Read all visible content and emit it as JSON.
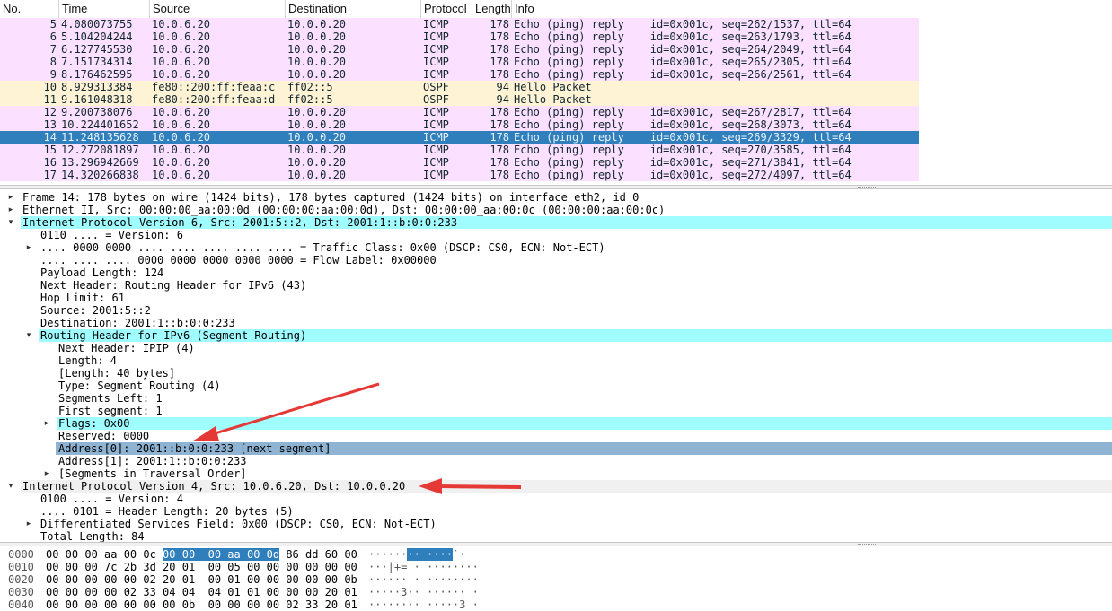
{
  "columns": [
    "No.",
    "Time",
    "Source",
    "Destination",
    "Protocol",
    "Length",
    "Info"
  ],
  "packets": [
    {
      "no": "5",
      "time": "4.080073755",
      "src": "10.0.6.20",
      "dst": "10.0.0.20",
      "proto": "ICMP",
      "len": "178",
      "info": "Echo (ping) reply    id=0x001c, seq=262/1537, ttl=64",
      "kind": "icmp"
    },
    {
      "no": "6",
      "time": "5.104204244",
      "src": "10.0.6.20",
      "dst": "10.0.0.20",
      "proto": "ICMP",
      "len": "178",
      "info": "Echo (ping) reply    id=0x001c, seq=263/1793, ttl=64",
      "kind": "icmp"
    },
    {
      "no": "7",
      "time": "6.127745530",
      "src": "10.0.6.20",
      "dst": "10.0.0.20",
      "proto": "ICMP",
      "len": "178",
      "info": "Echo (ping) reply    id=0x001c, seq=264/2049, ttl=64",
      "kind": "icmp"
    },
    {
      "no": "8",
      "time": "7.151734314",
      "src": "10.0.6.20",
      "dst": "10.0.0.20",
      "proto": "ICMP",
      "len": "178",
      "info": "Echo (ping) reply    id=0x001c, seq=265/2305, ttl=64",
      "kind": "icmp"
    },
    {
      "no": "9",
      "time": "8.176462595",
      "src": "10.0.6.20",
      "dst": "10.0.0.20",
      "proto": "ICMP",
      "len": "178",
      "info": "Echo (ping) reply    id=0x001c, seq=266/2561, ttl=64",
      "kind": "icmp"
    },
    {
      "no": "10",
      "time": "8.929313384",
      "src": "fe80::200:ff:feaa:c",
      "dst": "ff02::5",
      "proto": "OSPF",
      "len": "94",
      "info": "Hello Packet",
      "kind": "ospf"
    },
    {
      "no": "11",
      "time": "9.161048318",
      "src": "fe80::200:ff:feaa:d",
      "dst": "ff02::5",
      "proto": "OSPF",
      "len": "94",
      "info": "Hello Packet",
      "kind": "ospf"
    },
    {
      "no": "12",
      "time": "9.200738076",
      "src": "10.0.6.20",
      "dst": "10.0.0.20",
      "proto": "ICMP",
      "len": "178",
      "info": "Echo (ping) reply    id=0x001c, seq=267/2817, ttl=64",
      "kind": "icmp"
    },
    {
      "no": "13",
      "time": "10.224401652",
      "src": "10.0.6.20",
      "dst": "10.0.0.20",
      "proto": "ICMP",
      "len": "178",
      "info": "Echo (ping) reply    id=0x001c, seq=268/3073, ttl=64",
      "kind": "icmp"
    },
    {
      "no": "14",
      "time": "11.248135628",
      "src": "10.0.6.20",
      "dst": "10.0.0.20",
      "proto": "ICMP",
      "len": "178",
      "info": "Echo (ping) reply    id=0x001c, seq=269/3329, ttl=64",
      "kind": "sel"
    },
    {
      "no": "15",
      "time": "12.272081897",
      "src": "10.0.6.20",
      "dst": "10.0.0.20",
      "proto": "ICMP",
      "len": "178",
      "info": "Echo (ping) reply    id=0x001c, seq=270/3585, ttl=64",
      "kind": "icmp"
    },
    {
      "no": "16",
      "time": "13.296942669",
      "src": "10.0.6.20",
      "dst": "10.0.0.20",
      "proto": "ICMP",
      "len": "178",
      "info": "Echo (ping) reply    id=0x001c, seq=271/3841, ttl=64",
      "kind": "icmp"
    },
    {
      "no": "17",
      "time": "14.320266838",
      "src": "10.0.6.20",
      "dst": "10.0.0.20",
      "proto": "ICMP",
      "len": "178",
      "info": "Echo (ping) reply    id=0x001c, seq=272/4097, ttl=64",
      "kind": "icmp"
    }
  ],
  "details": [
    {
      "text": "Frame 14: 178 bytes on wire (1424 bits), 178 bytes captured (1424 bits) on interface eth2, id 0",
      "level": 0,
      "expander": "collapsed",
      "hl": ""
    },
    {
      "text": "Ethernet II, Src: 00:00:00_aa:00:0d (00:00:00:aa:00:0d), Dst: 00:00:00_aa:00:0c (00:00:00:aa:00:0c)",
      "level": 0,
      "expander": "collapsed",
      "hl": ""
    },
    {
      "text": "Internet Protocol Version 6, Src: 2001:5::2, Dst: 2001:1::b:0:0:233",
      "level": 0,
      "expander": "expanded",
      "hl": "cyan"
    },
    {
      "text": "0110 .... = Version: 6",
      "level": 1,
      "expander": "",
      "hl": ""
    },
    {
      "text": ".... 0000 0000 .... .... .... .... .... = Traffic Class: 0x00 (DSCP: CS0, ECN: Not-ECT)",
      "level": 1,
      "expander": "collapsed",
      "hl": ""
    },
    {
      "text": ".... .... .... 0000 0000 0000 0000 0000 = Flow Label: 0x00000",
      "level": 1,
      "expander": "",
      "hl": ""
    },
    {
      "text": "Payload Length: 124",
      "level": 1,
      "expander": "",
      "hl": ""
    },
    {
      "text": "Next Header: Routing Header for IPv6 (43)",
      "level": 1,
      "expander": "",
      "hl": ""
    },
    {
      "text": "Hop Limit: 61",
      "level": 1,
      "expander": "",
      "hl": ""
    },
    {
      "text": "Source: 2001:5::2",
      "level": 1,
      "expander": "",
      "hl": ""
    },
    {
      "text": "Destination: 2001:1::b:0:0:233",
      "level": 1,
      "expander": "",
      "hl": ""
    },
    {
      "text": "Routing Header for IPv6 (Segment Routing)",
      "level": 1,
      "expander": "expanded",
      "hl": "cyan"
    },
    {
      "text": "Next Header: IPIP (4)",
      "level": 2,
      "expander": "",
      "hl": ""
    },
    {
      "text": "Length: 4",
      "level": 2,
      "expander": "",
      "hl": ""
    },
    {
      "text": "[Length: 40 bytes]",
      "level": 2,
      "expander": "",
      "hl": ""
    },
    {
      "text": "Type: Segment Routing (4)",
      "level": 2,
      "expander": "",
      "hl": ""
    },
    {
      "text": "Segments Left: 1",
      "level": 2,
      "expander": "",
      "hl": ""
    },
    {
      "text": "First segment: 1",
      "level": 2,
      "expander": "",
      "hl": ""
    },
    {
      "text": "Flags: 0x00",
      "level": 2,
      "expander": "collapsed",
      "hl": "cyan"
    },
    {
      "text": "Reserved: 0000",
      "level": 2,
      "expander": "",
      "hl": ""
    },
    {
      "text": "Address[0]: 2001::b:0:0:233 [next segment]",
      "level": 2,
      "expander": "",
      "hl": "blue"
    },
    {
      "text": "Address[1]: 2001:1::b:0:0:233",
      "level": 2,
      "expander": "",
      "hl": ""
    },
    {
      "text": "[Segments in Traversal Order]",
      "level": 2,
      "expander": "collapsed",
      "hl": ""
    },
    {
      "text": "Internet Protocol Version 4, Src: 10.0.6.20, Dst: 10.0.0.20",
      "level": 0,
      "expander": "expanded",
      "hl": "grey"
    },
    {
      "text": "0100 .... = Version: 4",
      "level": 1,
      "expander": "",
      "hl": ""
    },
    {
      "text": ".... 0101 = Header Length: 20 bytes (5)",
      "level": 1,
      "expander": "",
      "hl": ""
    },
    {
      "text": "Differentiated Services Field: 0x00 (DSCP: CS0, ECN: Not-ECT)",
      "level": 1,
      "expander": "collapsed",
      "hl": ""
    },
    {
      "text": "Total Length: 84",
      "level": 1,
      "expander": "",
      "hl": ""
    }
  ],
  "bytes": [
    {
      "offset": "0000",
      "hex_pre": "00 00 00 aa 00 0c ",
      "hex_sel": "00 00  00 aa 00 0d",
      "hex_post": " 86 dd 60 00",
      "ascii_pre": "······",
      "ascii_sel": "·· ····",
      "ascii_post": "`·"
    },
    {
      "offset": "0010",
      "hex_pre": "00 00 00 7c 2b 3d 20 01  00 05 00 00 00 00 00 00",
      "hex_sel": "",
      "hex_post": "",
      "ascii_pre": "···|+= · ········",
      "ascii_sel": "",
      "ascii_post": ""
    },
    {
      "offset": "0020",
      "hex_pre": "00 00 00 00 00 02 20 01  00 01 00 00 00 00 00 0b",
      "hex_sel": "",
      "hex_post": "",
      "ascii_pre": "······ · ········",
      "ascii_sel": "",
      "ascii_post": ""
    },
    {
      "offset": "0030",
      "hex_pre": "00 00 00 00 02 33 04 04  04 01 01 00 00 00 20 01",
      "hex_sel": "",
      "hex_post": "",
      "ascii_pre": "·····3·· ······ ·",
      "ascii_sel": "",
      "ascii_post": ""
    },
    {
      "offset": "0040",
      "hex_pre": "00 00 00 00 00 00 00 0b  00 00 00 00 02 33 20 01",
      "hex_sel": "",
      "hex_post": "",
      "ascii_pre": "········ ·····3 ·",
      "ascii_sel": "",
      "ascii_post": ""
    }
  ],
  "colors": {
    "icmp_row": "#fce0ff",
    "ospf_row": "#fff3d6",
    "selected_row": "#2f7fbd",
    "tree_highlight": "#9ffcff",
    "field_selected": "#8eb3d3",
    "annotation_arrow": "#e53935"
  },
  "icons": {
    "collapsed": "triangle-right-icon",
    "expanded": "triangle-down-icon"
  }
}
